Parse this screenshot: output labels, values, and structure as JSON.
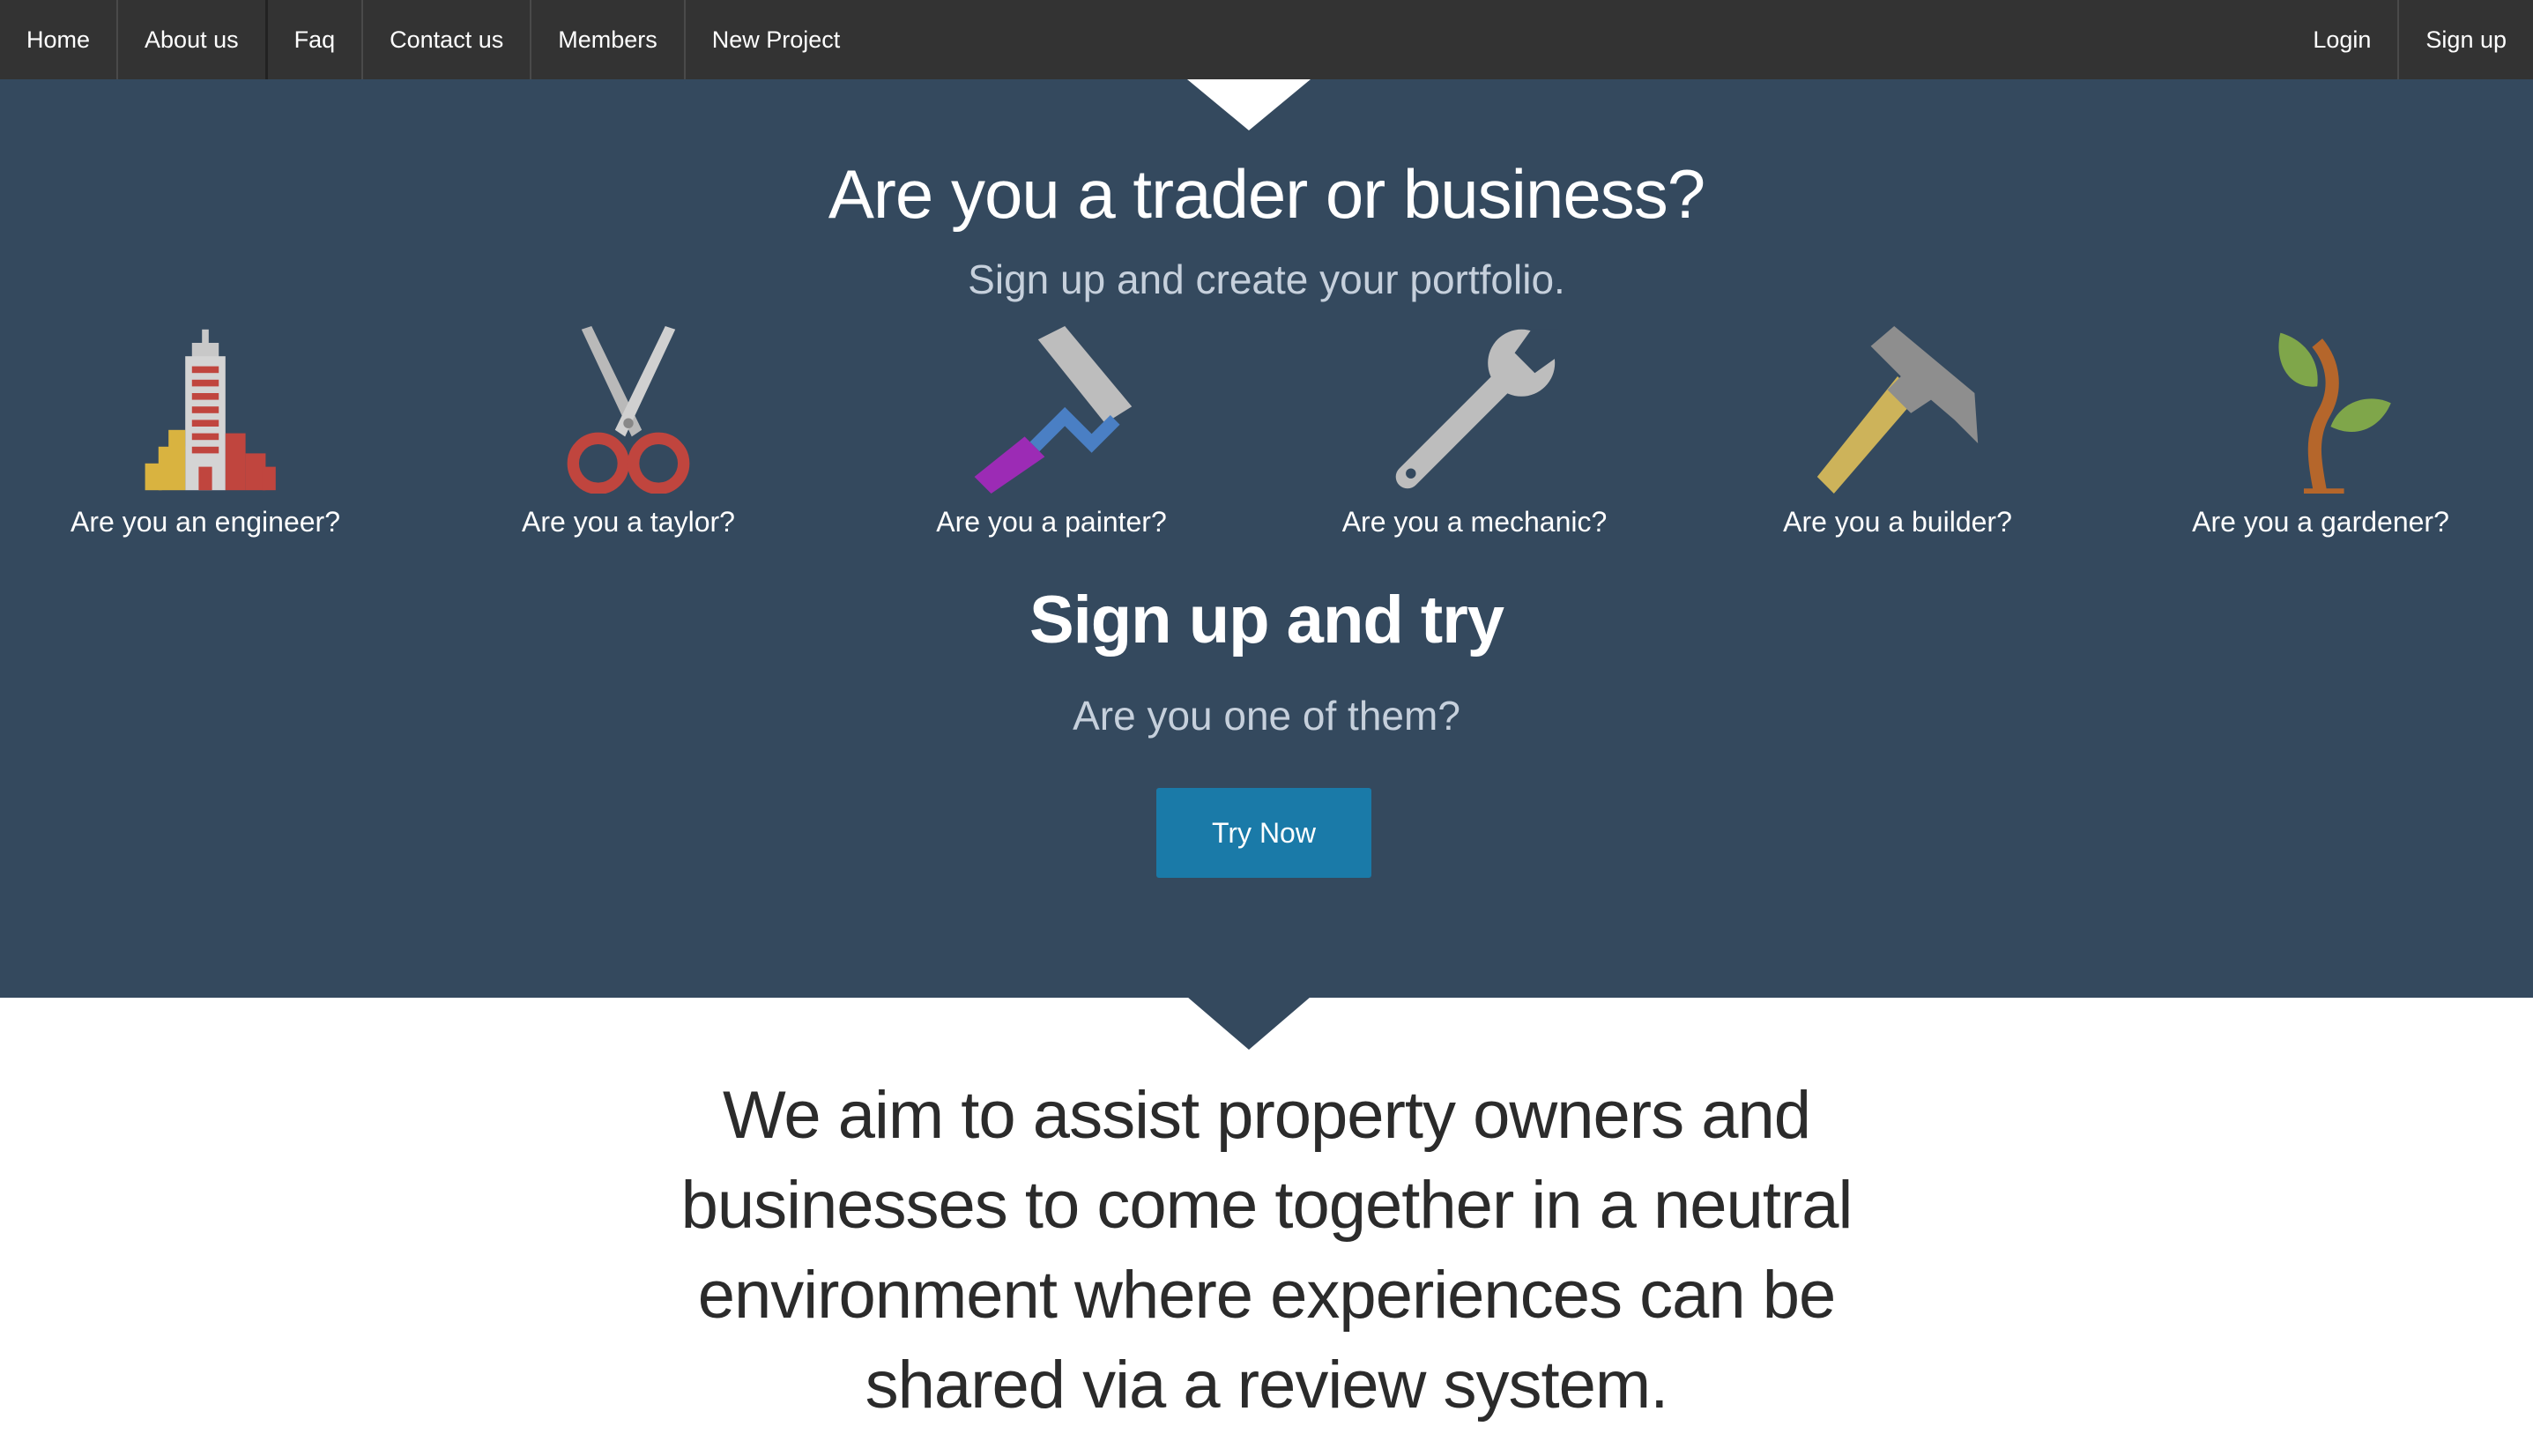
{
  "nav": {
    "left": [
      {
        "label": "Home"
      },
      {
        "label": "About us"
      },
      {
        "label": "Faq"
      },
      {
        "label": "Contact us"
      },
      {
        "label": "Members"
      },
      {
        "label": "New Project"
      }
    ],
    "right": [
      {
        "label": "Login"
      },
      {
        "label": "Sign up"
      }
    ]
  },
  "hero": {
    "title": "Are you a trader or business?",
    "subtitle": "Sign up and create your portfolio.",
    "trades": [
      {
        "label": "Are you an engineer?",
        "icon": "building-icon"
      },
      {
        "label": "Are you a taylor?",
        "icon": "scissors-icon"
      },
      {
        "label": "Are you a painter?",
        "icon": "paint-roller-icon"
      },
      {
        "label": "Are you a mechanic?",
        "icon": "wrench-icon"
      },
      {
        "label": "Are you a builder?",
        "icon": "hammer-icon"
      },
      {
        "label": "Are you a gardener?",
        "icon": "plant-icon"
      }
    ],
    "try_title": "Sign up and try",
    "try_subtitle": "Are you one of them?",
    "try_button": "Try Now"
  },
  "mission": {
    "text": "We aim to assist property owners and businesses to come together in a neutral environment where experiences can be shared via a review system."
  },
  "colors": {
    "navbar": "#333333",
    "hero_background": "#34495e",
    "button": "#1a7aa8"
  }
}
